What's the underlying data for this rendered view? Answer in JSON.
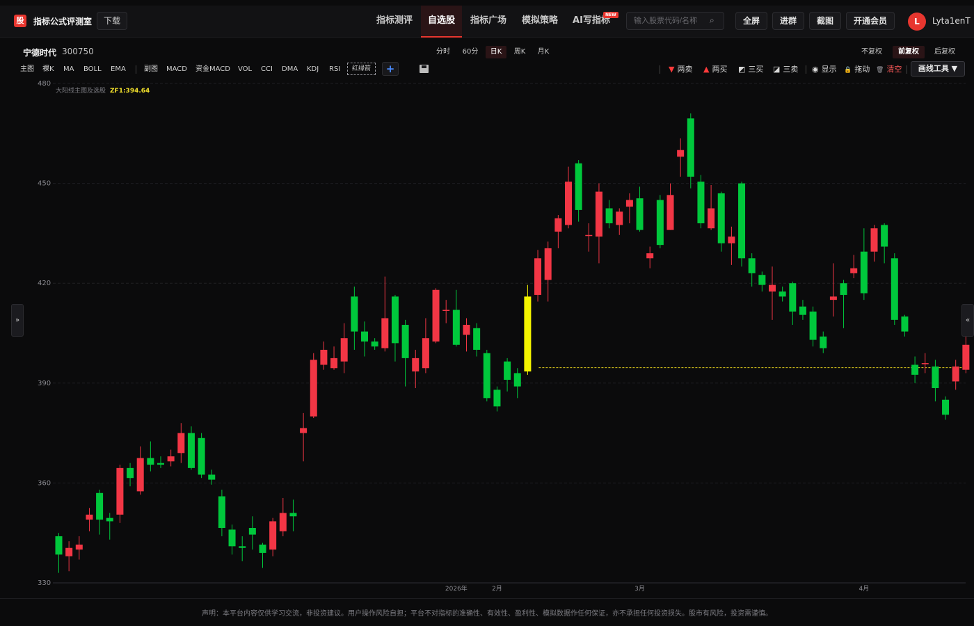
{
  "header": {
    "logo_char": "股",
    "brand": "指标公式评测室",
    "download": "下载",
    "nav": [
      {
        "label": "指标测评",
        "active": false
      },
      {
        "label": "自选股",
        "active": true
      },
      {
        "label": "指标广场",
        "active": false
      },
      {
        "label": "模拟策略",
        "active": false
      },
      {
        "label": "AI写指标",
        "active": false
      }
    ],
    "new_badge": "NEW",
    "search_placeholder": "输入股票代码/名称",
    "buttons": [
      "全屏",
      "进群",
      "截图",
      "开通会员"
    ],
    "avatar_initial": "L",
    "username": "Lyta1enT"
  },
  "stock": {
    "name": "宁德时代",
    "code": "300750",
    "periods": [
      "分时",
      "60分",
      "日K",
      "周K",
      "月K"
    ],
    "active_period": "日K",
    "adjust": [
      "不复权",
      "前复权",
      "后复权"
    ],
    "active_adjust": "前复权"
  },
  "indicators": {
    "main": [
      "主图",
      "裸K",
      "MA",
      "BOLL",
      "EMA"
    ],
    "sub": [
      "副图",
      "MACD",
      "资金MACD",
      "VOL",
      "CCI",
      "DMA",
      "KDJ",
      "RSI"
    ],
    "custom": "红绿箭",
    "plus": "+"
  },
  "draw_tools": {
    "items": [
      {
        "glyph": "▼",
        "label": "两卖",
        "color": "#ff3b3b"
      },
      {
        "glyph": "▲",
        "label": "两买",
        "color": "#ff3b3b"
      },
      {
        "glyph": "◩",
        "label": "三买",
        "color": "#e0e0e0"
      },
      {
        "glyph": "◪",
        "label": "三卖",
        "color": "#e0e0e0"
      },
      {
        "glyph": "◉",
        "label": "显示",
        "color": "#e0e0e0"
      },
      {
        "glyph": "🔒",
        "label": "拖动",
        "color": "#f2c14b"
      },
      {
        "glyph": "🗑",
        "label": "清空",
        "color": "#ff5a5a"
      }
    ],
    "menu": "画线工具 ▼"
  },
  "legend": {
    "name": "大阳线主图及选股",
    "zf": "ZF1:394.64"
  },
  "chart_data": {
    "type": "candlestick",
    "ylim": [
      330,
      480
    ],
    "yticks": [
      330,
      360,
      390,
      420,
      450,
      480
    ],
    "xticks": [
      {
        "index": 39,
        "label": "2026年"
      },
      {
        "index": 43,
        "label": "2月"
      },
      {
        "index": 57,
        "label": "3月"
      },
      {
        "index": 79,
        "label": "4月"
      }
    ],
    "reference_line": {
      "value": 394.64,
      "from_index": 46,
      "color": "#e6d21c"
    },
    "highlight_index": 46,
    "up_color": "#f23645",
    "down_color": "#00c83c",
    "highlight_color": "#f5f500",
    "candles": [
      [
        344.0,
        338.5,
        345.0,
        333.0
      ],
      [
        338.0,
        340.5,
        342.5,
        333.5
      ],
      [
        340.0,
        341.5,
        344.0,
        337.0
      ],
      [
        349.0,
        350.5,
        352.5,
        345.5
      ],
      [
        357.0,
        349.0,
        358.0,
        344.5
      ],
      [
        349.5,
        348.5,
        351.0,
        343.0
      ],
      [
        350.5,
        364.5,
        365.5,
        348.0
      ],
      [
        364.5,
        361.5,
        366.0,
        359.0
      ],
      [
        357.5,
        367.5,
        371.0,
        356.5
      ],
      [
        367.5,
        365.5,
        372.5,
        363.5
      ],
      [
        366.0,
        365.5,
        368.0,
        364.5
      ],
      [
        366.5,
        368.0,
        370.0,
        365.0
      ],
      [
        369.0,
        375.0,
        378.0,
        366.0
      ],
      [
        375.0,
        364.5,
        377.0,
        364.0
      ],
      [
        373.5,
        362.5,
        375.0,
        361.5
      ],
      [
        362.5,
        361.0,
        364.0,
        359.5
      ],
      [
        356.0,
        346.5,
        358.0,
        344.0
      ],
      [
        346.0,
        341.0,
        347.5,
        338.5
      ],
      [
        341.0,
        340.5,
        344.0,
        336.5
      ],
      [
        346.5,
        344.5,
        350.0,
        340.0
      ],
      [
        341.5,
        339.0,
        342.0,
        334.5
      ],
      [
        340.0,
        348.5,
        349.5,
        338.0
      ],
      [
        345.5,
        351.0,
        355.5,
        344.0
      ],
      [
        351.0,
        350.0,
        355.0,
        345.5
      ],
      [
        375.0,
        376.5,
        381.0,
        366.5
      ],
      [
        380.0,
        397.0,
        399.0,
        379.5
      ],
      [
        395.5,
        400.0,
        402.5,
        394.0
      ],
      [
        394.5,
        397.5,
        401.0,
        394.0
      ],
      [
        396.5,
        403.5,
        408.0,
        393.0
      ],
      [
        416.0,
        405.5,
        419.0,
        400.0
      ],
      [
        405.5,
        402.5,
        408.5,
        398.0
      ],
      [
        402.5,
        401.0,
        403.5,
        400.0
      ],
      [
        400.5,
        409.5,
        422.0,
        399.5
      ],
      [
        416.0,
        402.0,
        416.5,
        396.5
      ],
      [
        407.5,
        397.5,
        409.0,
        389.0
      ],
      [
        393.5,
        397.5,
        400.0,
        388.5
      ],
      [
        394.5,
        403.5,
        409.5,
        393.0
      ],
      [
        402.5,
        418.0,
        418.5,
        402.0
      ],
      [
        412.0,
        412.0,
        415.0,
        408.0
      ],
      [
        412.0,
        401.5,
        418.0,
        401.0
      ],
      [
        404.5,
        407.5,
        409.5,
        399.5
      ],
      [
        406.5,
        400.0,
        408.0,
        398.0
      ],
      [
        399.0,
        385.5,
        400.0,
        384.5
      ],
      [
        388.0,
        383.0,
        389.0,
        381.5
      ],
      [
        396.5,
        391.0,
        397.5,
        387.5
      ],
      [
        393.0,
        389.0,
        394.5,
        385.5
      ],
      [
        393.5,
        416.0,
        419.5,
        392.5
      ],
      [
        416.5,
        427.5,
        430.0,
        414.5
      ],
      [
        421.0,
        430.5,
        432.5,
        414.5
      ],
      [
        435.5,
        439.5,
        440.5,
        430.5
      ],
      [
        437.5,
        450.5,
        455.0,
        436.5
      ],
      [
        456.0,
        442.0,
        457.0,
        438.5
      ],
      [
        434.5,
        434.5,
        438.0,
        429.5
      ],
      [
        434.0,
        447.5,
        450.0,
        426.0
      ],
      [
        442.5,
        438.0,
        445.0,
        436.5
      ],
      [
        437.5,
        441.5,
        442.5,
        434.5
      ],
      [
        443.0,
        445.0,
        447.0,
        438.0
      ],
      [
        445.5,
        436.0,
        449.0,
        435.5
      ],
      [
        427.5,
        429.0,
        431.0,
        424.5
      ],
      [
        445.0,
        431.5,
        446.5,
        430.5
      ],
      [
        436.0,
        446.5,
        450.0,
        436.0
      ],
      [
        458.0,
        460.0,
        463.5,
        452.0
      ],
      [
        469.5,
        452.0,
        471.0,
        448.5
      ],
      [
        450.5,
        438.0,
        452.5,
        436.5
      ],
      [
        436.5,
        442.5,
        449.5,
        436.0
      ],
      [
        447.0,
        432.0,
        447.5,
        429.5
      ],
      [
        432.0,
        434.0,
        437.0,
        425.5
      ],
      [
        450.0,
        427.5,
        450.5,
        425.0
      ],
      [
        427.5,
        423.0,
        429.0,
        419.0
      ],
      [
        422.5,
        419.5,
        423.5,
        417.5
      ],
      [
        417.5,
        419.5,
        425.0,
        409.0
      ],
      [
        417.5,
        416.0,
        419.0,
        414.5
      ],
      [
        420.0,
        411.5,
        420.5,
        407.5
      ],
      [
        413.0,
        410.5,
        415.0,
        409.0
      ],
      [
        411.5,
        403.0,
        413.0,
        401.0
      ],
      [
        404.0,
        400.5,
        405.5,
        399.0
      ],
      [
        415.0,
        416.0,
        426.0,
        410.0
      ],
      [
        420.0,
        416.5,
        421.0,
        406.5
      ],
      [
        423.0,
        424.5,
        428.5,
        421.5
      ],
      [
        429.5,
        417.0,
        436.5,
        415.0
      ],
      [
        429.5,
        436.5,
        437.5,
        426.5
      ],
      [
        437.5,
        431.0,
        438.0,
        426.0
      ],
      [
        427.5,
        409.0,
        429.0,
        407.5
      ],
      [
        410.0,
        405.5,
        410.5,
        404.0
      ],
      [
        395.5,
        392.5,
        398.0,
        390.0
      ],
      [
        396.0,
        396.0,
        399.0,
        393.0
      ],
      [
        395.0,
        388.5,
        397.0,
        384.5
      ],
      [
        385.0,
        380.5,
        386.0,
        379.0
      ],
      [
        390.5,
        395.0,
        397.0,
        388.0
      ],
      [
        394.0,
        401.5,
        408.5,
        393.0
      ]
    ]
  },
  "disclaimer": "声明：本平台内容仅供学习交流，非投资建议。用户操作风险自担；平台不对指标的准确性、有效性、盈利性、模拟数据作任何保证，亦不承担任何投资损失。股市有风险，投资需谨慎。"
}
